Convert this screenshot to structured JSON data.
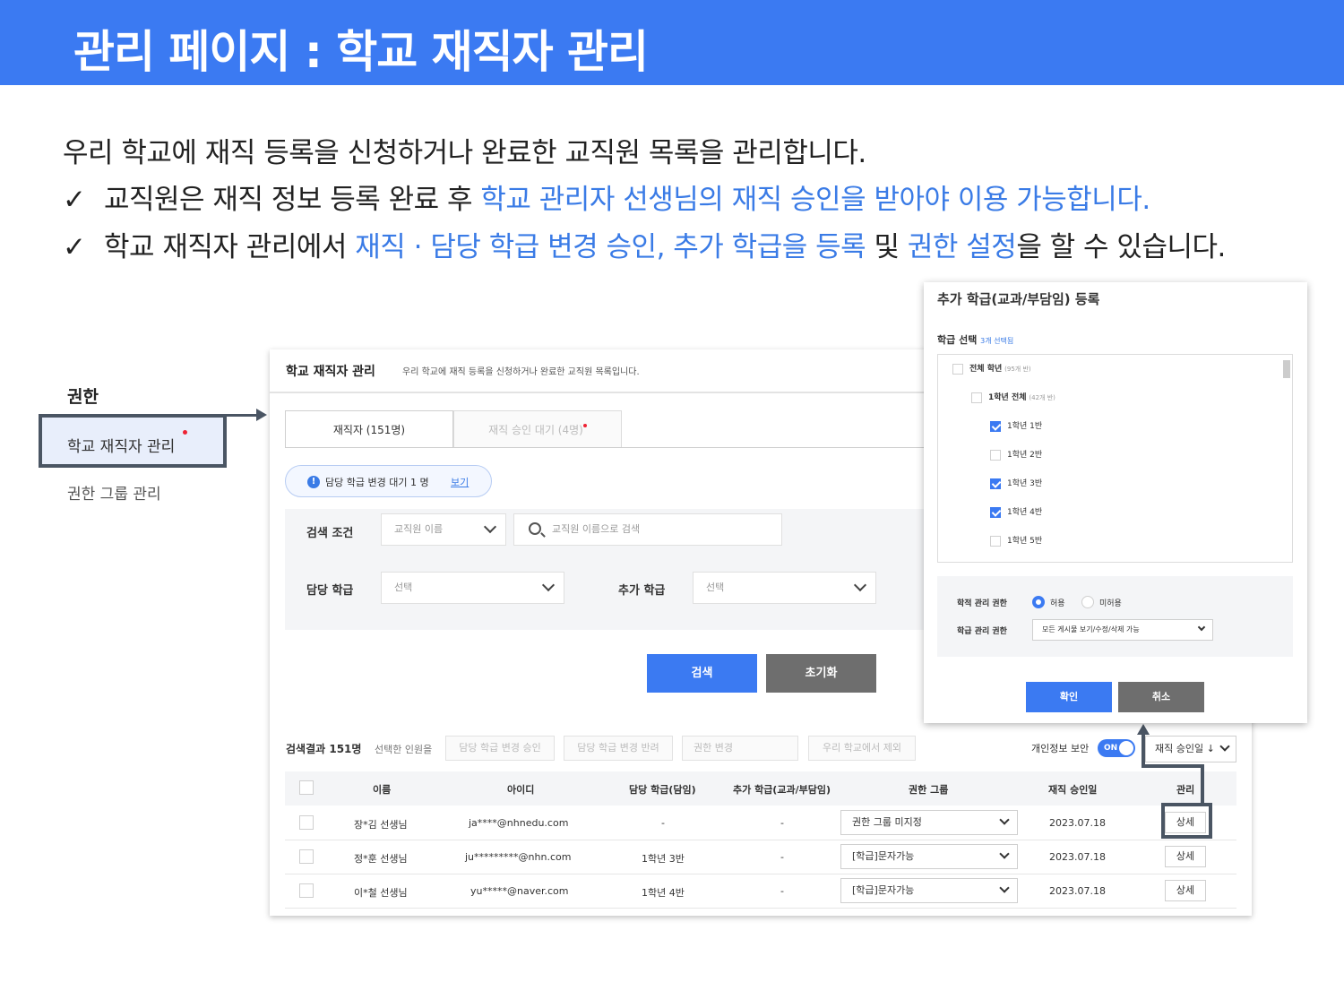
{
  "banner": {
    "title": "관리 페이지 : 학교 재직자 관리"
  },
  "intro": {
    "line": "우리 학교에 재직 등록을 신청하거나 완료한 교직원 목록을 관리합니다.",
    "bullet1": {
      "check": "✓",
      "plain": "교직원은 재직 정보 등록 완료 후 ",
      "highlight": "학교 관리자 선생님의 재직 승인을 받아야 이용 가능합니다."
    },
    "bullet2": {
      "check": "✓",
      "p1": "학교 재직자 관리에서 ",
      "h1": "재직 · 담당 학급 변경 승인, 추가 학급을 등록",
      "p2": " 및 ",
      "h2": "권한 설정",
      "p3": "을 할 수 있습니다."
    }
  },
  "sidebar": {
    "title": "권한",
    "items": [
      {
        "label": "학교 재직자 관리"
      },
      {
        "label": "권한 그룹 관리"
      }
    ]
  },
  "panel": {
    "title": "학교 재직자 관리",
    "subtitle": "우리 학교에 재직 등록을 신청하거나 완료한 교직원 목록입니다.",
    "tabs": [
      {
        "label": "재직자 (151명)"
      },
      {
        "label": "재직 승인 대기 (4명)"
      }
    ],
    "notice": {
      "icon": "!",
      "text": "담당 학급 변경 대기 1 명",
      "link": "보기"
    },
    "filter": {
      "search_label": "검색 조건",
      "search_field": "교직원 이름",
      "search_placeholder": "교직원 이름으로 검색",
      "homeroom_label": "담당 학급",
      "homeroom_value": "선택",
      "extra_label": "추가 학급",
      "extra_value": "선택"
    },
    "search_button": "검색",
    "reset_button": "초기화",
    "results": {
      "count": "검색결과 151명",
      "selected_label": "선택한 인원을",
      "actions": [
        "담당 학급 변경 승인",
        "담당 학급 변경 반려",
        "권한 변경",
        "우리 학교에서 제외"
      ],
      "privacy_label": "개인정보 보안",
      "privacy_toggle": "ON",
      "sort": "재직 승인일 ↓"
    },
    "table": {
      "headers": [
        "이름",
        "아이디",
        "담당 학급(담임)",
        "추가 학급(교과/부담임)",
        "권한 그룹",
        "재직 승인일",
        "관리"
      ],
      "rows": [
        {
          "name": "장*김 선생님",
          "id": "ja****@nhnedu.com",
          "homeroom": "-",
          "extra": "-",
          "group": "권한 그룹 미지정",
          "date": "2023.07.18",
          "action": "상세"
        },
        {
          "name": "정*훈 선생님",
          "id": "ju*********@nhn.com",
          "homeroom": "1학년 3반",
          "extra": "-",
          "group": "[학급]문자가능",
          "date": "2023.07.18",
          "action": "상세"
        },
        {
          "name": "이*철 선생님",
          "id": "yu*****@naver.com",
          "homeroom": "1학년 4반",
          "extra": "-",
          "group": "[학급]문자가능",
          "date": "2023.07.18",
          "action": "상세"
        }
      ]
    }
  },
  "modal": {
    "title": "추가 학급(교과/부담임) 등록",
    "section": "학급 선택",
    "section_note": "3개 선택됨",
    "list": [
      {
        "label": "전체 학년",
        "note": "(95개 반)",
        "checked": false
      },
      {
        "label": "1학년 전체",
        "note": "(42개 반)",
        "checked": false
      },
      {
        "label": "1학년 1반",
        "note": "",
        "checked": true
      },
      {
        "label": "1학년 2반",
        "note": "",
        "checked": false
      },
      {
        "label": "1학년 3반",
        "note": "",
        "checked": true
      },
      {
        "label": "1학년 4반",
        "note": "",
        "checked": true
      },
      {
        "label": "1학년 5반",
        "note": "",
        "checked": false
      }
    ],
    "perm1_label": "학적 관리 권한",
    "perm1_opt_on": "허용",
    "perm1_opt_off": "미허용",
    "perm2_label": "학급 관리 권한",
    "perm2_value": "모든 게시물 보기/수정/삭제 가능",
    "ok": "확인",
    "cancel": "취소"
  },
  "colors": {
    "accent": "#3b7af2",
    "highlight_text": "#3a7be6",
    "annotation": "#4a5563",
    "dark_button": "#6e6e6e"
  }
}
